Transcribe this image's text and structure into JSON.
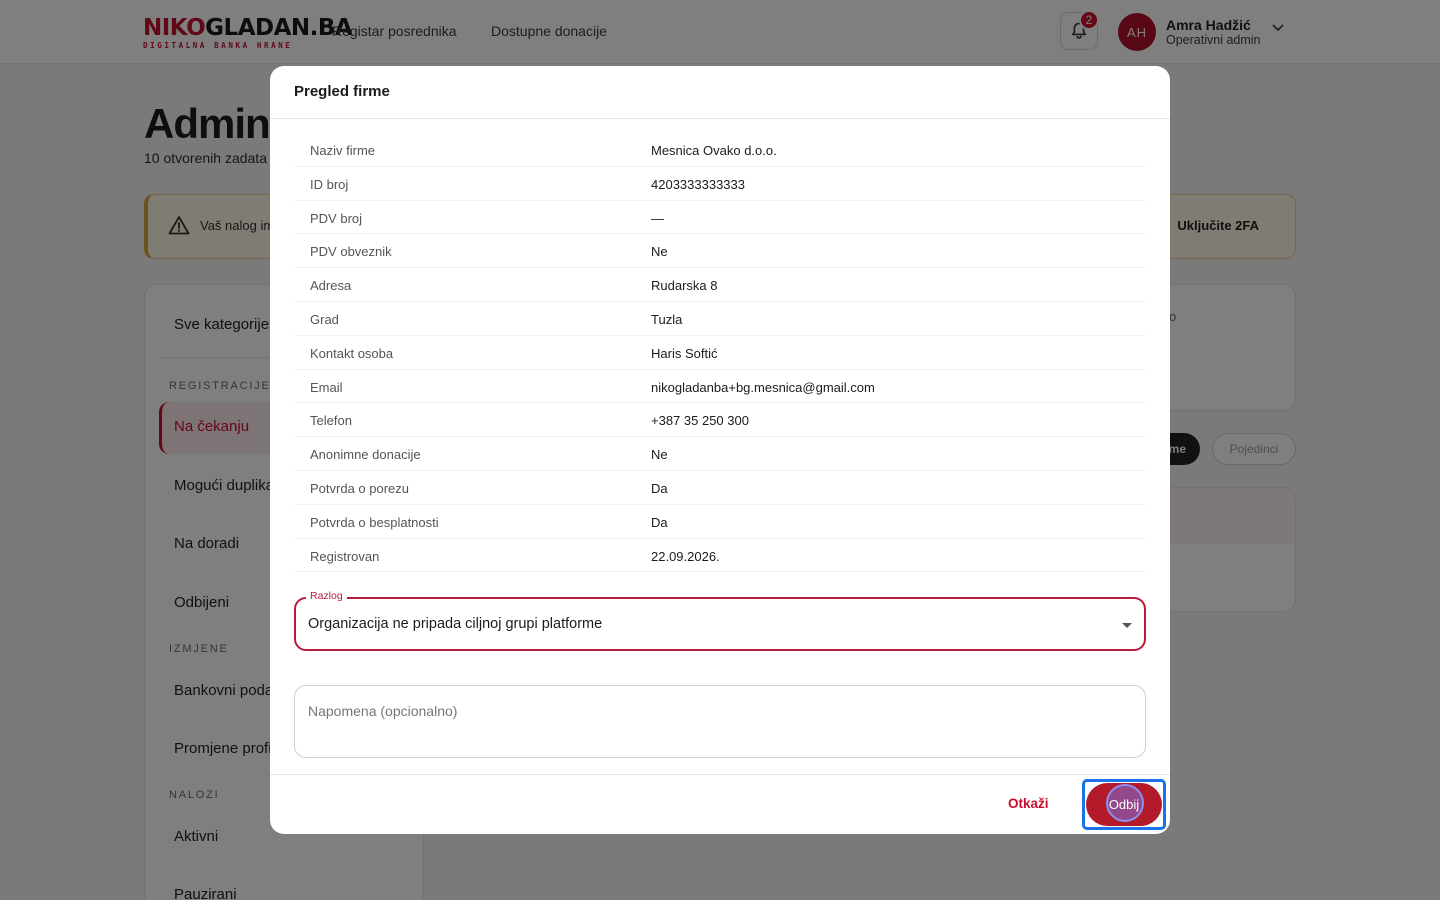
{
  "header": {
    "logo_main_a": "NIKO",
    "logo_main_b": "GLADAN.BA",
    "logo_sub": "DIGITALNA BANKA HRANE",
    "nav": [
      "Registar posrednika",
      "Dostupne donacije"
    ],
    "notifications_count": "2",
    "user": {
      "initials": "AH",
      "name": "Amra Hadžić",
      "role": "Operativni admin"
    }
  },
  "page": {
    "title": "Admini",
    "subtitle": "10 otvorenih zadata",
    "alert": {
      "text": "Vaš nalog im",
      "action": "Uključite 2FA"
    }
  },
  "sidebar": {
    "first": "Sve kategorije",
    "sections": [
      {
        "title": "REGISTRACIJE",
        "items": [
          "Na čekanju",
          "Mogući duplika",
          "Na doradi",
          "Odbijeni"
        ]
      },
      {
        "title": "IZMJENE",
        "items": [
          "Bankovni poda",
          "Promjene profi"
        ]
      },
      {
        "title": "NALOZI",
        "items": [
          "Aktivni",
          "Pauzirani"
        ]
      }
    ]
  },
  "right": {
    "card_text": "o",
    "chip_active": "me",
    "chip_inactive": "Pojedinci"
  },
  "modal": {
    "title": "Pregled firme",
    "rows": [
      {
        "label": "Naziv firme",
        "value": "Mesnica Ovako d.o.o."
      },
      {
        "label": "ID broj",
        "value": "4203333333333"
      },
      {
        "label": "PDV broj",
        "value": "—"
      },
      {
        "label": "PDV obveznik",
        "value": "Ne"
      },
      {
        "label": "Adresa",
        "value": "Rudarska 8"
      },
      {
        "label": "Grad",
        "value": "Tuzla"
      },
      {
        "label": "Kontakt osoba",
        "value": "Haris Softić"
      },
      {
        "label": "Email",
        "value": "nikogladanba+bg.mesnica@gmail.com"
      },
      {
        "label": "Telefon",
        "value": "+387 35 250 300"
      },
      {
        "label": "Anonimne donacije",
        "value": "Ne"
      },
      {
        "label": "Potvrda o porezu",
        "value": "Da"
      },
      {
        "label": "Potvrda o besplatnosti",
        "value": "Da"
      },
      {
        "label": "Registrovan",
        "value": "22.09.2026."
      }
    ],
    "reason": {
      "label": "Razlog",
      "value": "Organizacija ne pripada ciljnoj grupi platforme"
    },
    "note": {
      "placeholder": "Napomena (opcionalno)",
      "value": ""
    },
    "cancel_label": "Otkaži",
    "reject_label": "Odbij"
  },
  "colors": {
    "brand_red": "#c41230",
    "reject_button": "#b31b2b",
    "focus_ring": "#1a73e8",
    "field_border": "#b71c3c"
  },
  "icons": [
    "bell-icon",
    "chevron-down-icon",
    "warning-icon",
    "dropdown-caret-icon"
  ]
}
